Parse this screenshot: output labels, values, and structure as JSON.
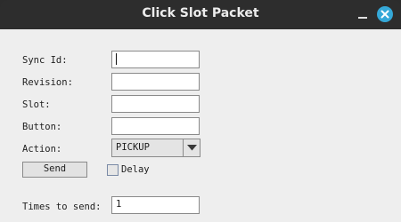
{
  "window": {
    "title": "Click Slot Packet"
  },
  "form": {
    "sync_id_label": "Sync Id:",
    "sync_id_value": "",
    "revision_label": "Revision:",
    "revision_value": "",
    "slot_label": "Slot:",
    "slot_value": "",
    "button_label": "Button:",
    "button_value": "",
    "action_label": "Action:",
    "action_selected": "PICKUP",
    "send_label": "Send",
    "delay_label": "Delay",
    "delay_checked": false,
    "times_label": "Times to send:",
    "times_value": "1"
  },
  "icons": {
    "minimize": "minimize-icon",
    "close": "close-icon",
    "dropdown": "chevron-down-icon"
  },
  "colors": {
    "titlebar": "#2d2d2d",
    "close_accent": "#35a8d8",
    "panel": "#eeeeee"
  }
}
